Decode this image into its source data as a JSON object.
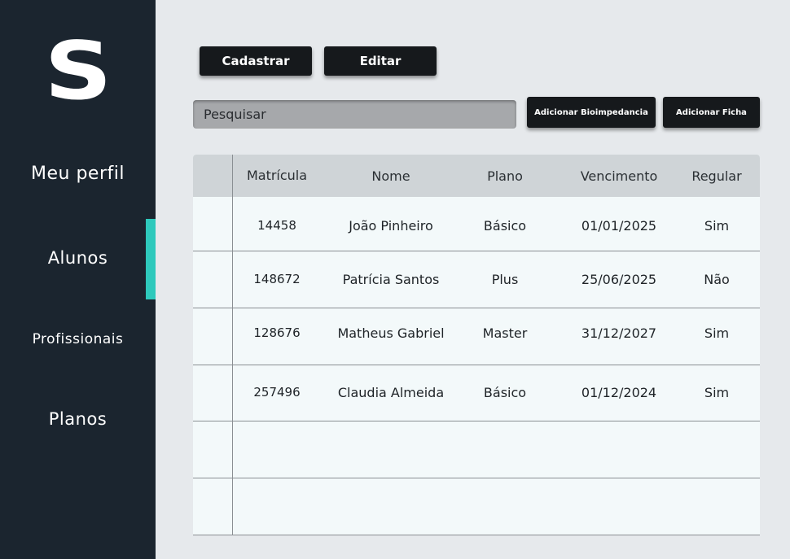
{
  "sidebar": {
    "logo": "S",
    "items": [
      {
        "label": "Meu perfil"
      },
      {
        "label": "Alunos",
        "active": true
      },
      {
        "label": "Profissionais"
      },
      {
        "label": "Planos"
      }
    ],
    "accent_color": "#2ec9bc"
  },
  "toolbar": {
    "cadastrar_label": "Cadastrar",
    "editar_label": "Editar",
    "bioimpedancia_label": "Adicionar Bioimpedancia",
    "ficha_label": "Adicionar Ficha"
  },
  "search": {
    "placeholder": "Pesquisar"
  },
  "table": {
    "columns": [
      "Matrícula",
      "Nome",
      "Plano",
      "Vencimento",
      "Regular"
    ],
    "rows": [
      [
        "14458",
        "João Pinheiro",
        "Básico",
        "01/01/2025",
        "Sim"
      ],
      [
        "148672",
        "Patrícia Santos",
        "Plus",
        "25/06/2025",
        "Não"
      ],
      [
        "128676",
        "Matheus Gabriel",
        "Master",
        "31/12/2027",
        "Sim"
      ],
      [
        "257496",
        "Claudia Almeida",
        "Básico",
        "01/12/2024",
        "Sim"
      ]
    ]
  },
  "colors": {
    "sidebar_bg": "#1b252f",
    "page_bg": "#e6e9ec",
    "button_bg": "#16191c",
    "table_header_bg": "#cfd4d7",
    "table_body_bg": "#f3f9fa"
  }
}
